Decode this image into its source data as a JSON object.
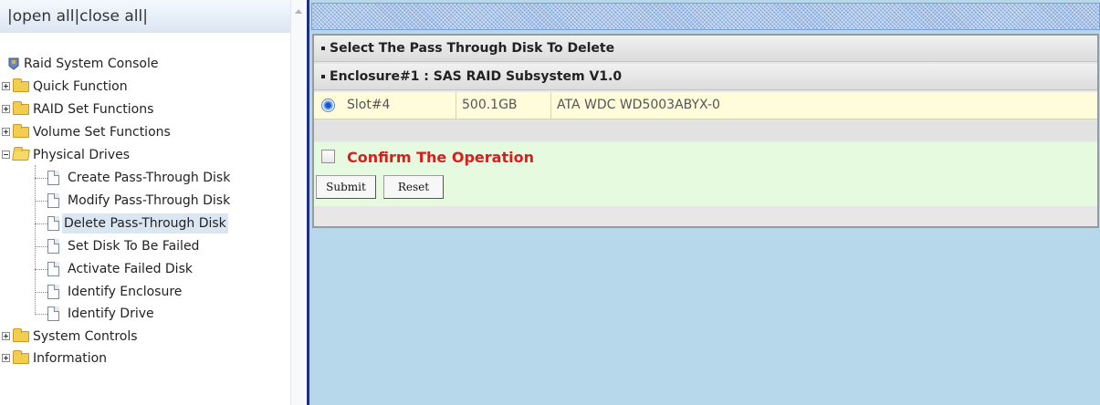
{
  "nav": {
    "top_links": {
      "open_all": "open all",
      "close_all": "close all",
      "separator": "|"
    },
    "tree": {
      "root": "Raid System Console",
      "items": [
        {
          "label": "Quick Function",
          "expanded": false
        },
        {
          "label": "RAID Set Functions",
          "expanded": false
        },
        {
          "label": "Volume Set Functions",
          "expanded": false
        },
        {
          "label": "Physical Drives",
          "expanded": true
        },
        {
          "label": "System Controls",
          "expanded": false
        },
        {
          "label": "Information",
          "expanded": false
        }
      ],
      "physical_drives_children": [
        "Create Pass-Through Disk",
        "Modify Pass-Through Disk",
        "Delete Pass-Through Disk",
        "Set Disk To Be Failed",
        "Activate Failed Disk",
        "Identify Enclosure",
        "Identify Drive"
      ],
      "selected": "Delete Pass-Through Disk"
    }
  },
  "main": {
    "section_title": "Select The Pass Through Disk To Delete",
    "enclosure_title": "Enclosure#1 : SAS RAID Subsystem V1.0",
    "disks": [
      {
        "slot": "Slot#4",
        "capacity": "500.1GB",
        "model": "ATA WDC WD5003ABYX-0",
        "selected": true
      }
    ],
    "confirm_label": "Confirm The Operation",
    "confirm_checked": false,
    "submit_label": "Submit",
    "reset_label": "Reset"
  },
  "colors": {
    "nav_selected_bg": "#dbe6f3",
    "content_bg": "#b7d7ea",
    "frame_border": "#1d2f8a",
    "disk_row_bg": "#fffcdc",
    "confirm_bg": "#e6fadf",
    "confirm_text": "#d61f1f"
  }
}
